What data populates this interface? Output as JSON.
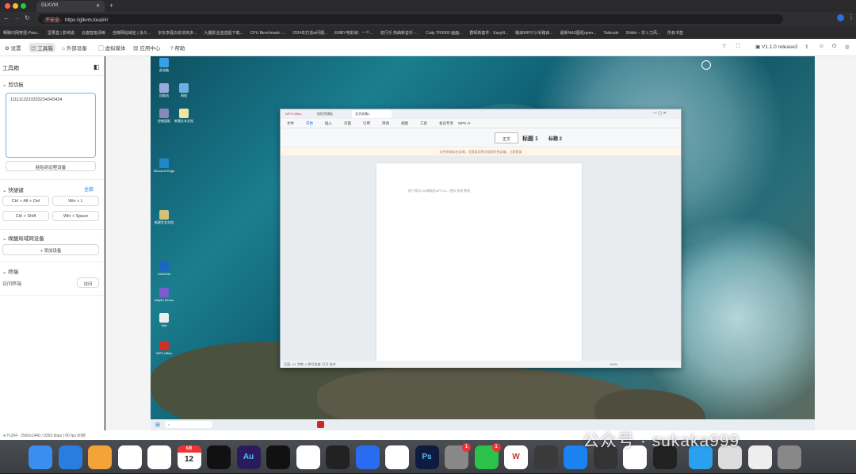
{
  "browser": {
    "tab_title": "GLKVM",
    "url": "https://glkvm.local/#/",
    "security_label": "不安全"
  },
  "bookmarks": [
    "畅聊内网穿透-Pass...",
    "坚果盒 | 影响说",
    "云盘智能清晰",
    "自媒网站域名 | 永久...",
    "京东李嘉白杂货商多...",
    "九畿影业首选提下载...",
    "CPU Benchmark -...",
    "2024年打造ai问题...",
    "EMBY电影城：一个...",
    "流行乐 热曲新音乐 -...",
    "Cuity TR3000 画面...",
    "群晖新套件：EasyN...",
    "路由WIFI7小米路由...",
    "最新NAS图机open...",
    "Tailscale",
    "Shiblo – 非卜力风...",
    "所有书签"
  ],
  "toolbar": {
    "settings": "设置",
    "tools": "工具箱",
    "external": "外部设备",
    "virtual_media": "虚拟媒体",
    "app_center": "应用中心",
    "help": "帮助",
    "version": "V1.1.0 release2"
  },
  "panel": {
    "title": "工具箱",
    "clipboard": {
      "title": "剪切板",
      "content": "1111113233333234343434",
      "paste_button": "粘贴到远程设备"
    },
    "shortcuts": {
      "title": "快捷键",
      "all_link": "全部",
      "keys": [
        "Ctrl + Alt + Del",
        "Win + L",
        "Ctrl + Shift",
        "Win + Space"
      ]
    },
    "wol": {
      "title": "唤醒局域网设备",
      "add_button": "+ 添加设备"
    },
    "terminal": {
      "title": "终端",
      "label": "访问终端",
      "button": "访问"
    }
  },
  "status_bar": "H.264 · 2560x1440 / 9393 kbps | 60 fps 60帧",
  "desktop_icons": [
    {
      "label": "此电脑"
    },
    {
      "label": "回收站"
    },
    {
      "label": "Microsoft Edge"
    },
    {
      "label": "网络"
    },
    {
      "label": "控制面板"
    },
    {
      "label": "新建文本文档"
    },
    {
      "label": "新建文本文档"
    },
    {
      "label": "LinkDesk"
    },
    {
      "label": "Jellyfin Server"
    },
    {
      "label": "Wal"
    },
    {
      "label": "WPS Office"
    }
  ],
  "wps": {
    "tabs": [
      "WPS Office",
      "找稻壳模板",
      "文字文稿1"
    ],
    "menu": [
      "文件",
      "开始",
      "插入",
      "页面",
      "引用",
      "审阅",
      "视图",
      "工具",
      "会员专享",
      "WPS AI"
    ],
    "styles": [
      "正文",
      "标题 1",
      "标题 2"
    ],
    "warning": "文件仅保存在本地，可登录后将文档同步到云端。立即登录",
    "doc_hint": "按下两次Ctrl键唤起WPS AI，使用 快速 教程",
    "status": "页面: 1/1   字数: 0   拼写检查: 打开   校对",
    "zoom": "100%"
  },
  "watermark": "公众号 · sukaka999",
  "dock_icons": [
    "finder-icon",
    "safari-icon",
    "launchpad-icon",
    "reminders-icon",
    "settings-icon",
    "calendar-icon",
    "capcut-icon",
    "audition-icon",
    "capcut2-icon",
    "apple-icon",
    "final-cut-icon",
    "dingtalk-icon",
    "chrome-icon",
    "photoshop-icon",
    "system-settings-icon",
    "wechat-icon",
    "wps-icon",
    "obs-icon",
    "appstore-icon",
    "browser-icon",
    "photos-icon",
    "facetime-icon",
    "folder-icon",
    "downloads-icon",
    "files-icon",
    "trash-icon"
  ],
  "dock_badges": {
    "system_settings": "1",
    "wechat": "1"
  },
  "calendar": {
    "month": "5月",
    "day": "12"
  },
  "colors": {
    "accent": "#1677ff",
    "panel_border": "#7ab7e3",
    "ocean_deep": "#0d4f62",
    "ocean_light": "#1a7e8f"
  }
}
